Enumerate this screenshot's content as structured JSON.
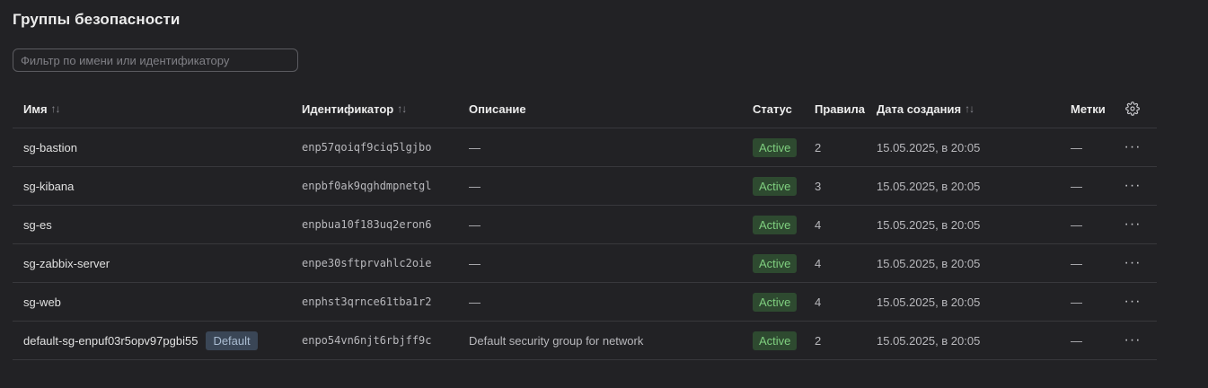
{
  "page": {
    "title": "Группы безопасности"
  },
  "search": {
    "placeholder": "Фильтр по имени или идентификатору"
  },
  "table": {
    "columns": {
      "name": "Имя",
      "id": "Идентификатор",
      "description": "Описание",
      "status": "Статус",
      "rules": "Правила",
      "created": "Дата создания",
      "tags": "Метки"
    },
    "sort_icon": "sort-arrows-icon",
    "settings_icon": "gear-icon",
    "rows": [
      {
        "name": "sg-bastion",
        "badge": "",
        "id": "enp57qoiqf9ciq5lgjbo",
        "description": "—",
        "status": "Active",
        "rules": "2",
        "created": "15.05.2025, в 20:05",
        "tags": "—",
        "menu": "···"
      },
      {
        "name": "sg-kibana",
        "badge": "",
        "id": "enpbf0ak9qghdmpnetgl",
        "description": "—",
        "status": "Active",
        "rules": "3",
        "created": "15.05.2025, в 20:05",
        "tags": "—",
        "menu": "···"
      },
      {
        "name": "sg-es",
        "badge": "",
        "id": "enpbua10f183uq2eron6",
        "description": "—",
        "status": "Active",
        "rules": "4",
        "created": "15.05.2025, в 20:05",
        "tags": "—",
        "menu": "···"
      },
      {
        "name": "sg-zabbix-server",
        "badge": "",
        "id": "enpe30sftprvahlc2oie",
        "description": "—",
        "status": "Active",
        "rules": "4",
        "created": "15.05.2025, в 20:05",
        "tags": "—",
        "menu": "···"
      },
      {
        "name": "sg-web",
        "badge": "",
        "id": "enphst3qrnce61tba1r2",
        "description": "—",
        "status": "Active",
        "rules": "4",
        "created": "15.05.2025, в 20:05",
        "tags": "—",
        "menu": "···"
      },
      {
        "name": "default-sg-enpuf03r5opv97pgbi55",
        "badge": "Default",
        "id": "enpo54vn6njt6rbjff9c",
        "description": "Default security group for network",
        "status": "Active",
        "rules": "2",
        "created": "15.05.2025, в 20:05",
        "tags": "—",
        "menu": "···"
      }
    ]
  },
  "colors": {
    "background": "#222225",
    "status_active_bg": "#2e4a30",
    "status_active_text": "#7fcf7f",
    "default_badge_bg": "#3a4656"
  }
}
